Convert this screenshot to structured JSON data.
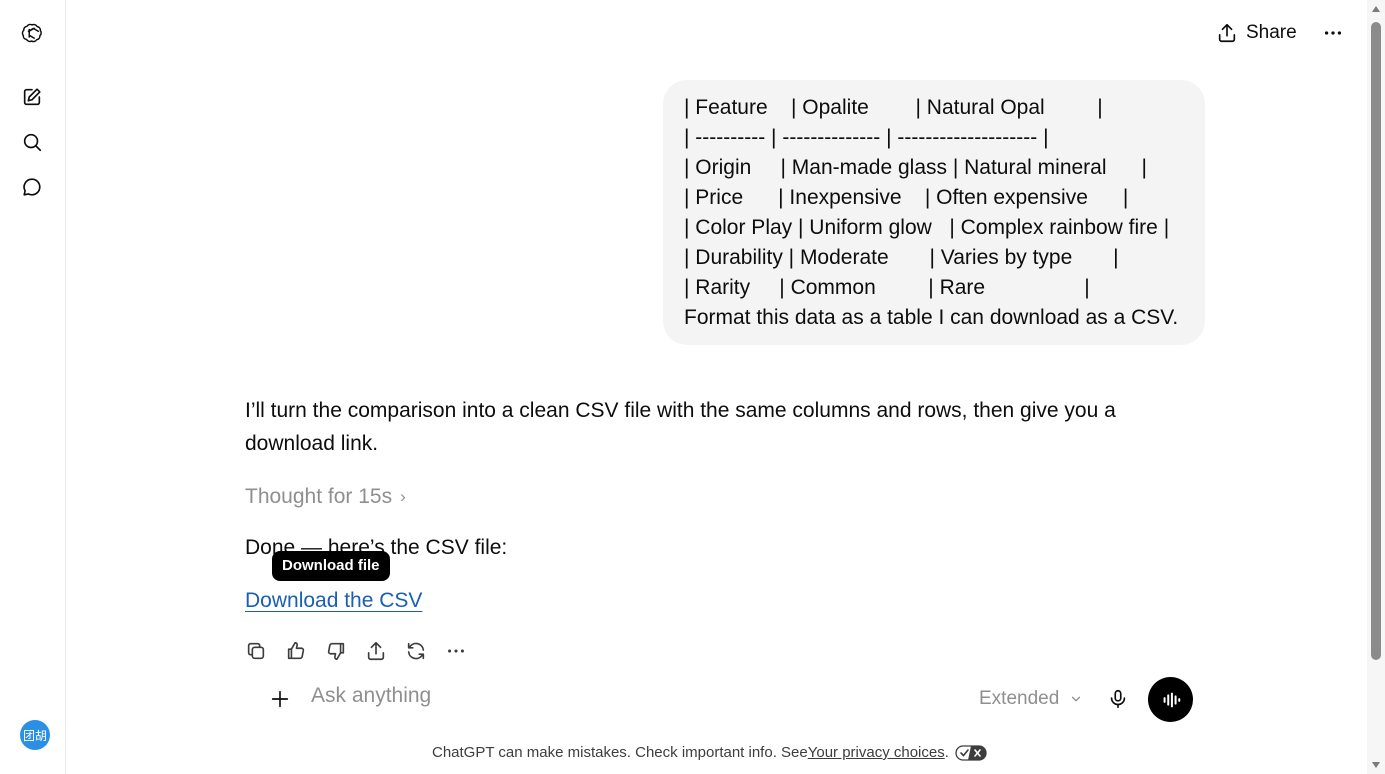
{
  "header": {
    "share_label": "Share"
  },
  "sidebar": {
    "avatar_text": "团胡"
  },
  "user_message": {
    "lines": [
      "| Feature    | Opalite        | Natural Opal         |",
      "| ---------- | -------------- | -------------------- |",
      "| Origin     | Man-made glass | Natural mineral      |",
      "| Price      | Inexpensive    | Often expensive      |",
      "| Color Play | Uniform glow   | Complex rainbow fire |",
      "| Durability | Moderate       | Varies by type       |",
      "| Rarity     | Common         | Rare                 |",
      "Format this data as a table I can download as a CSV."
    ]
  },
  "assistant": {
    "intro": "I’ll turn the comparison into a clean CSV file with the same columns and rows, then give you a download link.",
    "thought_label": "Thought for 15s",
    "thought_chevron": "›",
    "done_text": "Done — here’s the CSV file:",
    "tooltip": "Download file",
    "download_link": "Download the CSV"
  },
  "composer": {
    "placeholder": "Ask anything",
    "mode": "Extended"
  },
  "footer": {
    "disclaimer": "ChatGPT can make mistakes. Check important info. See ",
    "privacy_link": "Your privacy choices",
    "period": "."
  },
  "colors": {
    "link": "#1a5fb4",
    "bubble": "#f4f4f4",
    "muted": "#8f8f8f"
  }
}
